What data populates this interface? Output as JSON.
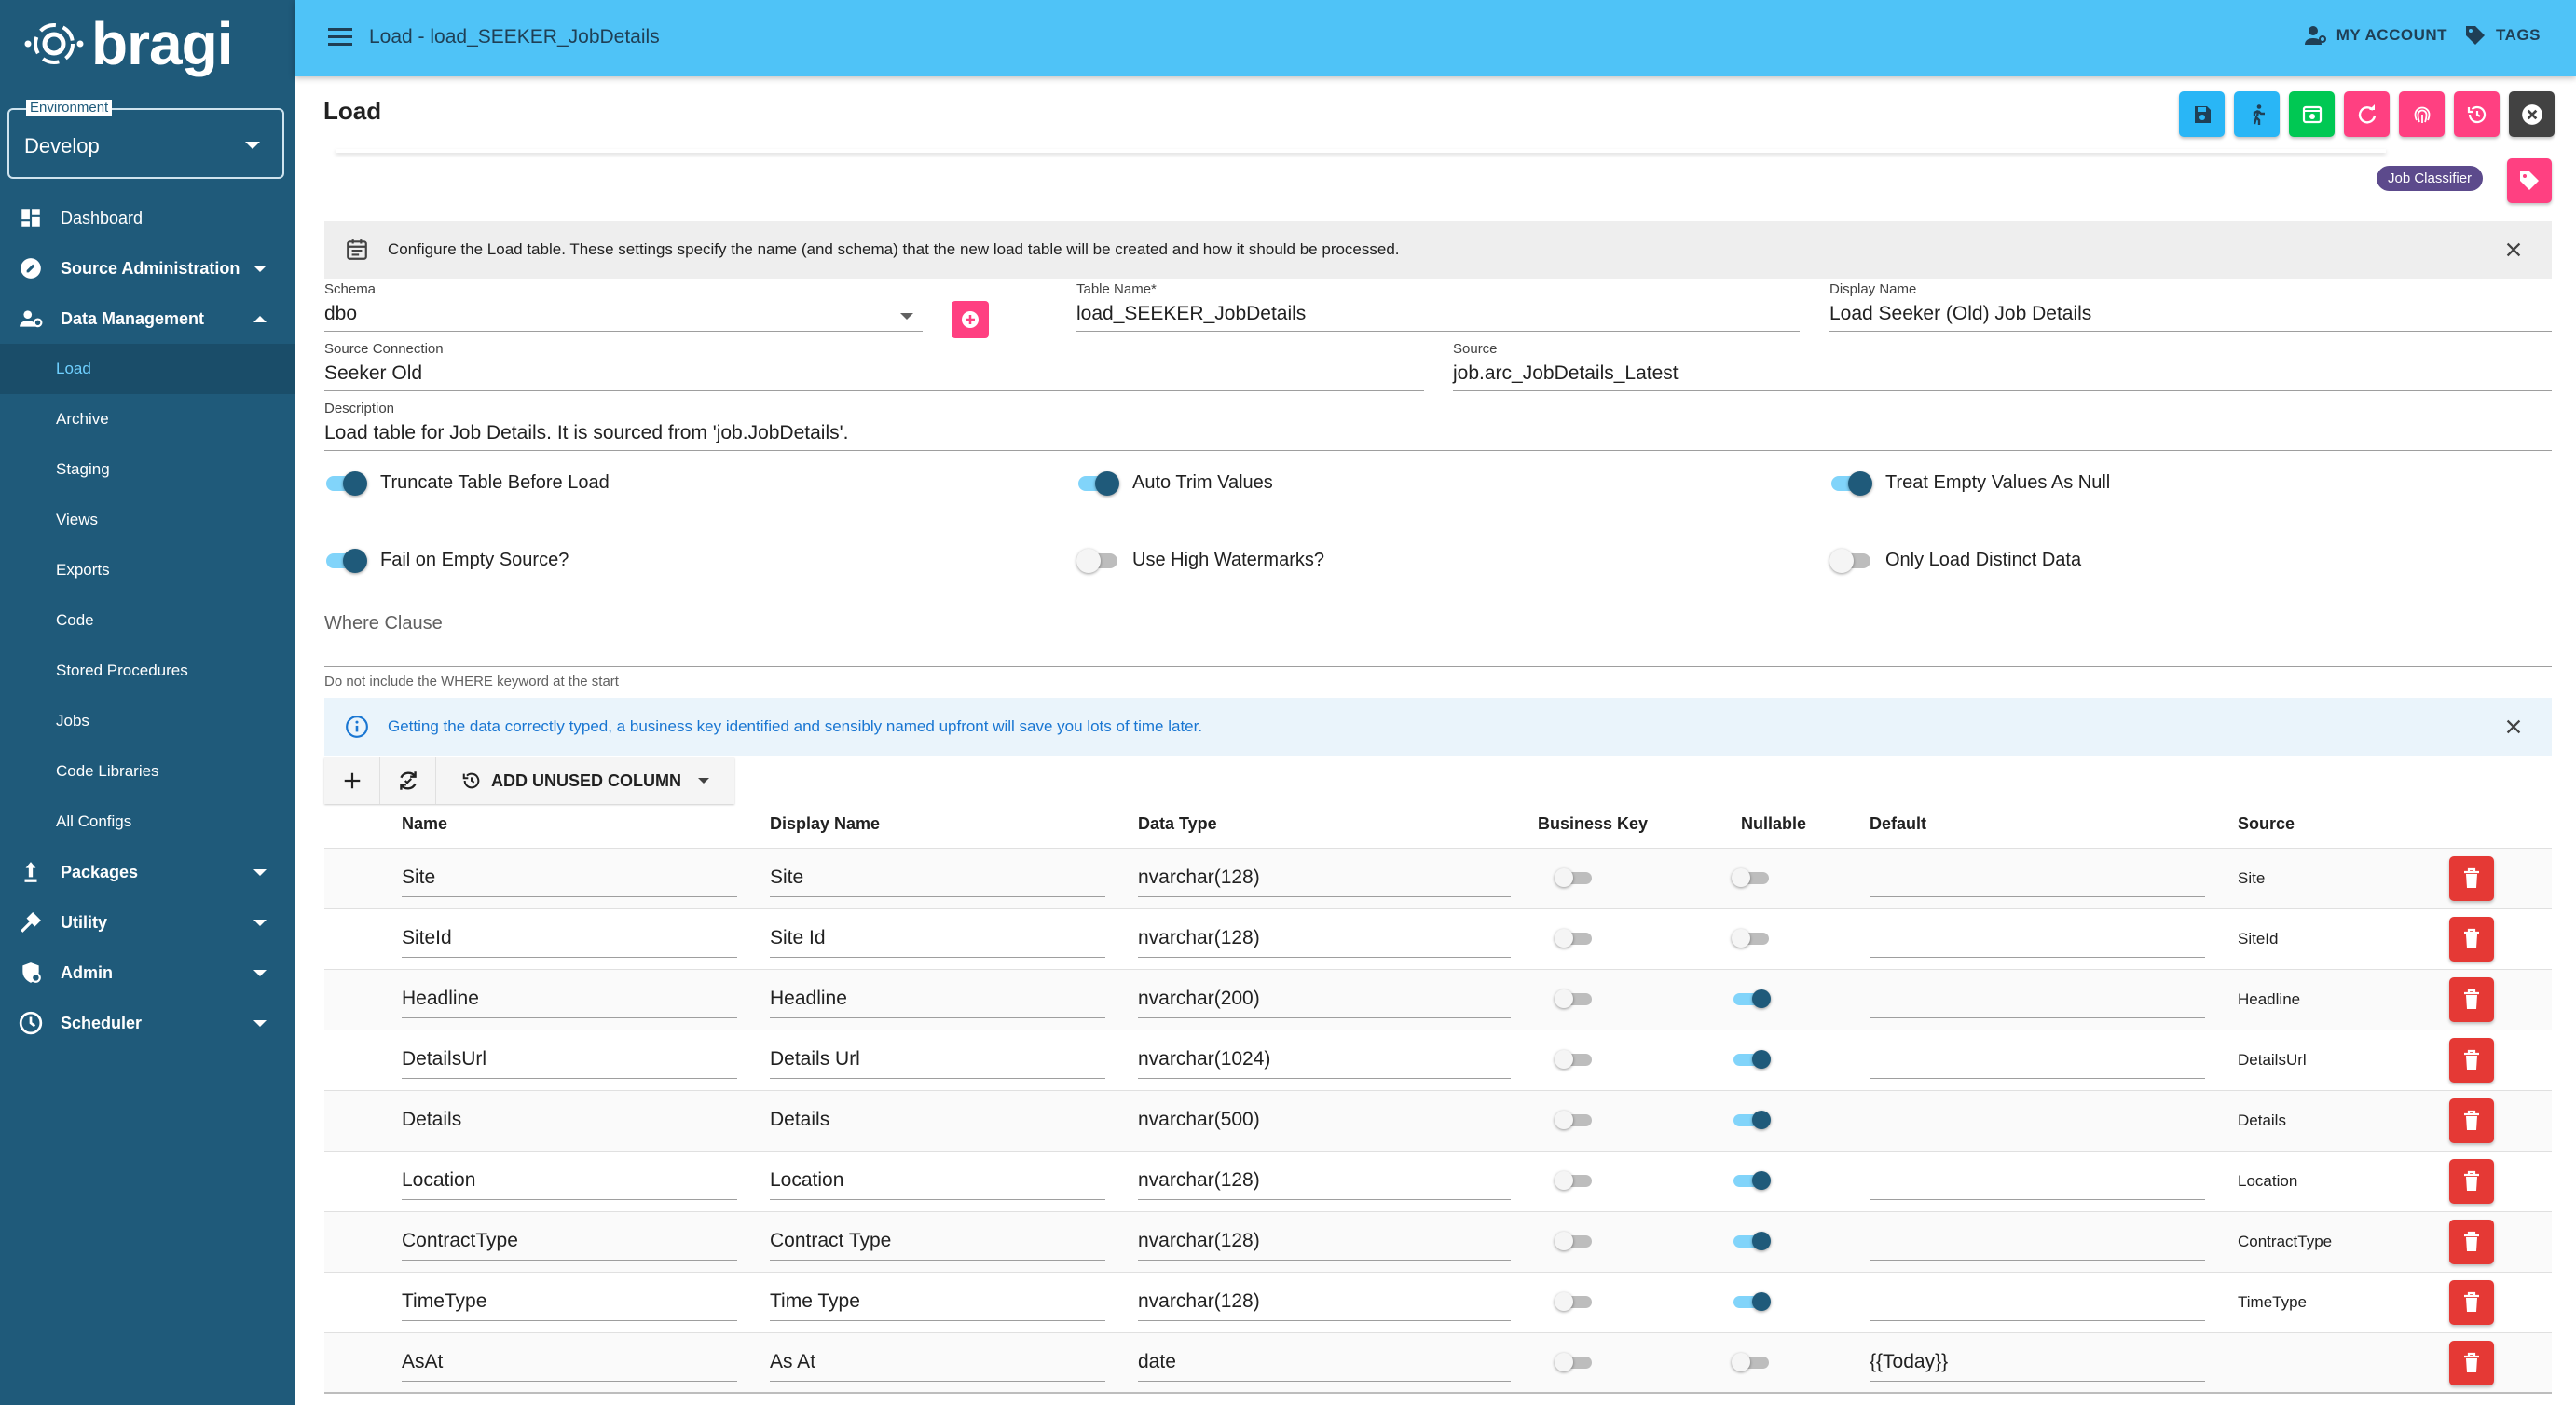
{
  "app": {
    "logo_text": "bragi"
  },
  "environment": {
    "label": "Environment",
    "value": "Develop"
  },
  "sidebar": {
    "items": [
      {
        "label": "Dashboard",
        "icon": "dashboard-icon",
        "kind": "top",
        "caret": ""
      },
      {
        "label": "Source Administration",
        "icon": "source-icon",
        "kind": "top-bold",
        "caret": "down"
      },
      {
        "label": "Data Management",
        "icon": "data-management-icon",
        "kind": "top-bold",
        "caret": "up"
      },
      {
        "label": "Load",
        "kind": "sub-active"
      },
      {
        "label": "Archive",
        "kind": "sub"
      },
      {
        "label": "Staging",
        "kind": "sub"
      },
      {
        "label": "Views",
        "kind": "sub"
      },
      {
        "label": "Exports",
        "kind": "sub"
      },
      {
        "label": "Code",
        "kind": "sub"
      },
      {
        "label": "Stored Procedures",
        "kind": "sub"
      },
      {
        "label": "Jobs",
        "kind": "sub"
      },
      {
        "label": "Code Libraries",
        "kind": "sub"
      },
      {
        "label": "All Configs",
        "kind": "sub"
      },
      {
        "label": "Packages",
        "icon": "packages-icon",
        "kind": "top-bold",
        "caret": "down"
      },
      {
        "label": "Utility",
        "icon": "utility-icon",
        "kind": "top-bold",
        "caret": "down"
      },
      {
        "label": "Admin",
        "icon": "admin-icon",
        "kind": "top-bold",
        "caret": "down"
      },
      {
        "label": "Scheduler",
        "icon": "scheduler-icon",
        "kind": "top-bold",
        "caret": "down"
      }
    ]
  },
  "header": {
    "title": "Load - load_SEEKER_JobDetails",
    "my_account": "MY ACCOUNT",
    "tags": "TAGS"
  },
  "page": {
    "title": "Load",
    "tag_chip": "Job Classifier",
    "actions": [
      {
        "name": "save-button",
        "color": "#29b6f6"
      },
      {
        "name": "run-button",
        "color": "#29b6f6"
      },
      {
        "name": "preview-button",
        "color": "#00c853"
      },
      {
        "name": "refresh-button",
        "color": "#ff4081"
      },
      {
        "name": "fingerprint-button",
        "color": "#ff4081"
      },
      {
        "name": "history-button",
        "color": "#ff4081"
      },
      {
        "name": "close-button",
        "color": "#424242"
      }
    ]
  },
  "info_banner": "Configure the Load table. These settings specify the name (and schema) that the new load table will be created and how it should be processed.",
  "tip_banner": "Getting the data correctly typed, a business key identified and sensibly named upfront will save you lots of time later.",
  "form": {
    "schema": {
      "label": "Schema",
      "value": "dbo"
    },
    "table_name": {
      "label": "Table Name*",
      "value": "load_SEEKER_JobDetails"
    },
    "display_name": {
      "label": "Display Name",
      "value": "Load Seeker (Old) Job Details"
    },
    "source_connection": {
      "label": "Source Connection",
      "value": "Seeker Old"
    },
    "source": {
      "label": "Source",
      "value": "job.arc_JobDetails_Latest"
    },
    "description": {
      "label": "Description",
      "value": "Load table for Job Details. It is sourced from 'job.JobDetails'."
    },
    "toggles": {
      "truncate": {
        "label": "Truncate Table Before Load",
        "on": true
      },
      "auto_trim": {
        "label": "Auto Trim Values",
        "on": true
      },
      "treat_empty": {
        "label": "Treat Empty Values As Null",
        "on": true
      },
      "fail_empty": {
        "label": "Fail on Empty Source?",
        "on": true
      },
      "high_watermarks": {
        "label": "Use High Watermarks?",
        "on": false
      },
      "distinct": {
        "label": "Only Load Distinct Data",
        "on": false
      }
    },
    "where_clause": {
      "label": "Where Clause",
      "hint": "Do not include the WHERE keyword at the start"
    }
  },
  "columns_toolbar": {
    "add_unused": "ADD UNUSED COLUMN"
  },
  "table": {
    "headers": {
      "name": "Name",
      "display_name": "Display Name",
      "data_type": "Data Type",
      "business_key": "Business Key",
      "nullable": "Nullable",
      "default": "Default",
      "source": "Source"
    },
    "rows": [
      {
        "name": "Site",
        "display": "Site",
        "type": "nvarchar(128)",
        "bk": false,
        "nullable": false,
        "default": "",
        "source": "Site"
      },
      {
        "name": "SiteId",
        "display": "Site Id",
        "type": "nvarchar(128)",
        "bk": false,
        "nullable": false,
        "default": "",
        "source": "SiteId"
      },
      {
        "name": "Headline",
        "display": "Headline",
        "type": "nvarchar(200)",
        "bk": false,
        "nullable": true,
        "default": "",
        "source": "Headline"
      },
      {
        "name": "DetailsUrl",
        "display": "Details Url",
        "type": "nvarchar(1024)",
        "bk": false,
        "nullable": true,
        "default": "",
        "source": "DetailsUrl"
      },
      {
        "name": "Details",
        "display": "Details",
        "type": "nvarchar(500)",
        "bk": false,
        "nullable": true,
        "default": "",
        "source": "Details"
      },
      {
        "name": "Location",
        "display": "Location",
        "type": "nvarchar(128)",
        "bk": false,
        "nullable": true,
        "default": "",
        "source": "Location"
      },
      {
        "name": "ContractType",
        "display": "Contract Type",
        "type": "nvarchar(128)",
        "bk": false,
        "nullable": true,
        "default": "",
        "source": "ContractType"
      },
      {
        "name": "TimeType",
        "display": "Time Type",
        "type": "nvarchar(128)",
        "bk": false,
        "nullable": true,
        "default": "",
        "source": "TimeType"
      },
      {
        "name": "AsAt",
        "display": "As At",
        "type": "date",
        "bk": false,
        "nullable": false,
        "default": "{{Today}}",
        "source": ""
      }
    ]
  }
}
